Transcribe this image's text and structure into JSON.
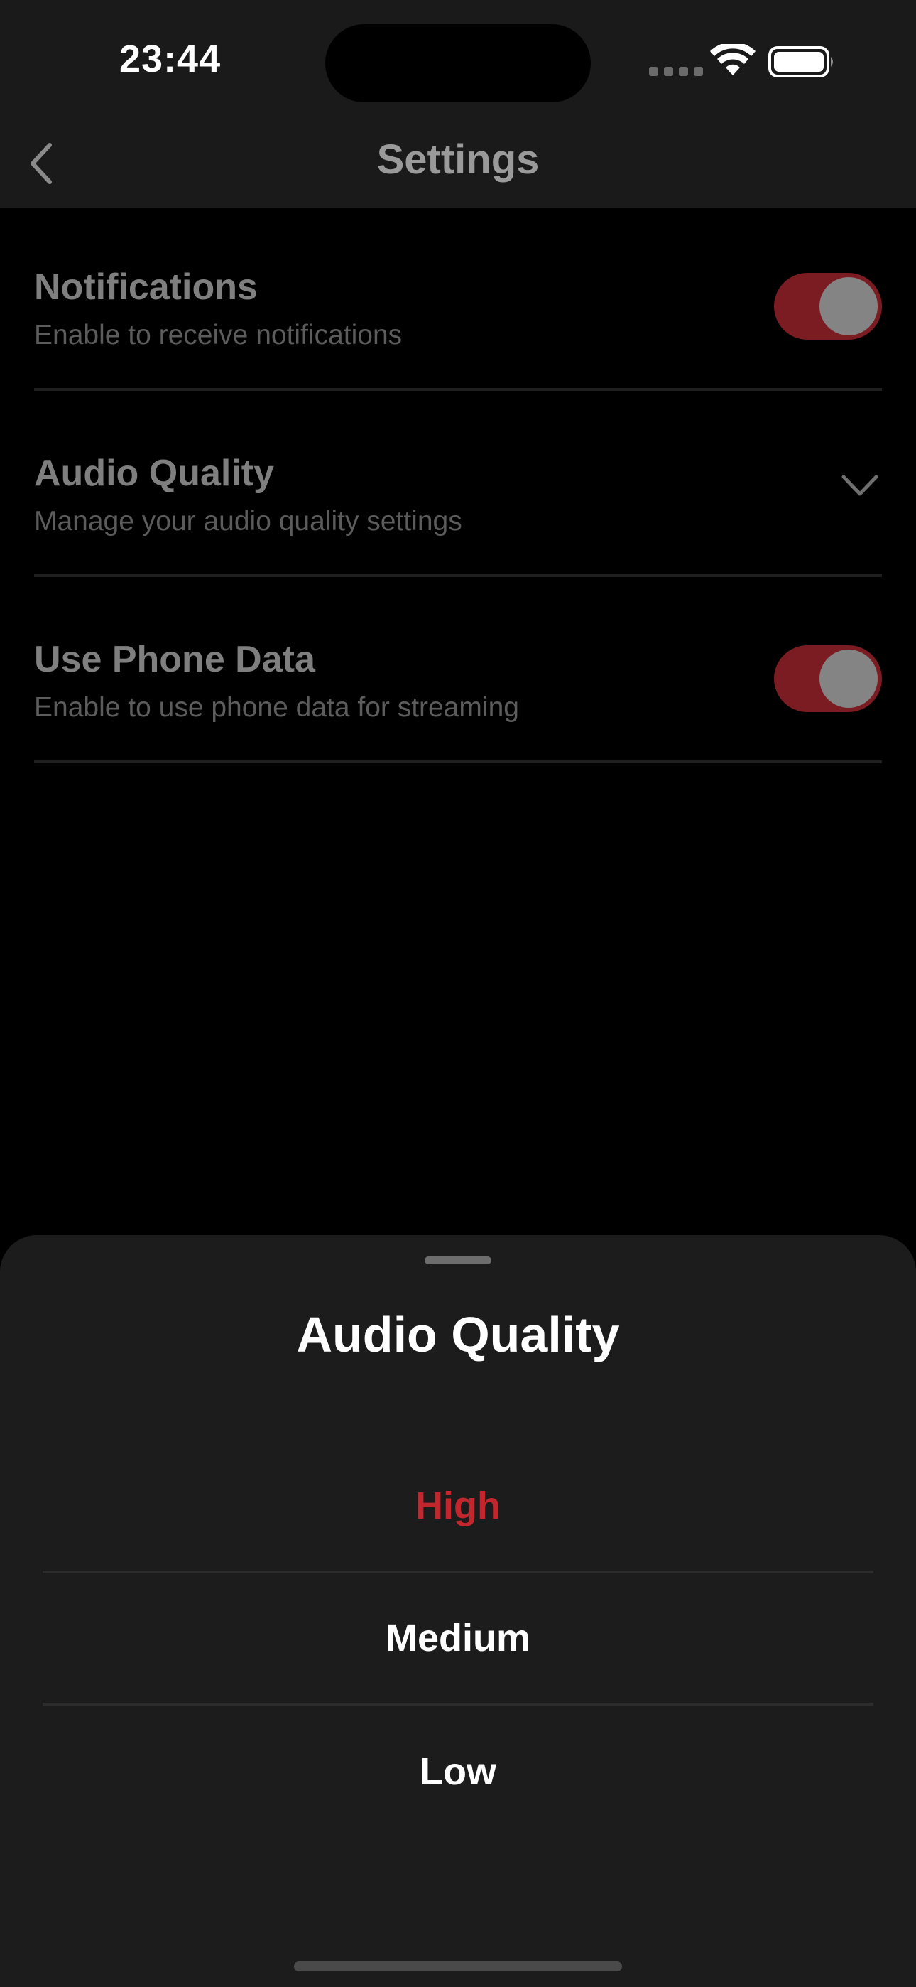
{
  "status_bar": {
    "time": "23:44",
    "icons": [
      "cellular-icon",
      "wifi-icon",
      "battery-icon"
    ]
  },
  "nav": {
    "title": "Settings",
    "back_icon": "chevron-left-icon"
  },
  "settings": [
    {
      "title": "Notifications",
      "subtitle": "Enable to receive notifications",
      "control": "toggle",
      "on": true
    },
    {
      "title": "Audio Quality",
      "subtitle": "Manage your audio quality settings",
      "control": "chevron-down-icon"
    },
    {
      "title": "Use Phone Data",
      "subtitle": "Enable to use phone data for streaming",
      "control": "toggle",
      "on": true
    }
  ],
  "sheet": {
    "title": "Audio Quality",
    "options": [
      {
        "label": "High",
        "selected": true
      },
      {
        "label": "Medium",
        "selected": false
      },
      {
        "label": "Low",
        "selected": false
      }
    ]
  },
  "colors": {
    "accent": "#c1272d",
    "toggle_on_dimmed": "#7a1c22",
    "sheet_background": "#1c1c1c",
    "nav_background": "#1a1a1a"
  }
}
